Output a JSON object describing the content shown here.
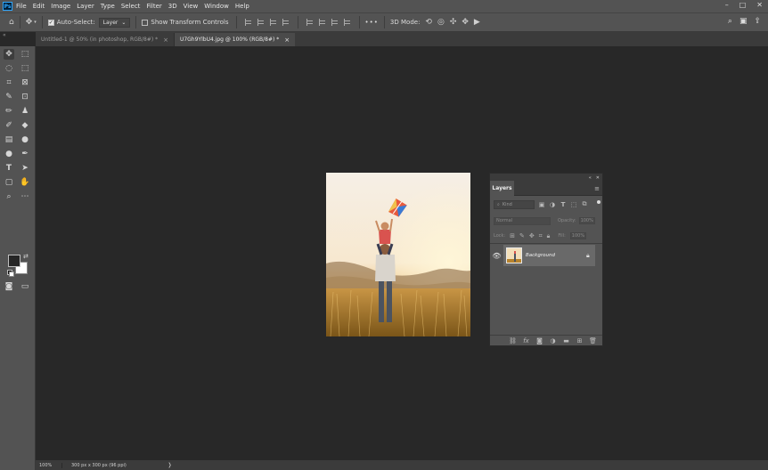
{
  "app": {
    "logo": "Ps"
  },
  "menu": [
    "File",
    "Edit",
    "Image",
    "Layer",
    "Type",
    "Select",
    "Filter",
    "3D",
    "View",
    "Window",
    "Help"
  ],
  "window_controls": [
    "–",
    "□",
    "✕"
  ],
  "options_bar": {
    "auto_select_label": "Auto-Select:",
    "auto_select_checked": true,
    "target_select": "Layer",
    "show_transform_controls_label": "Show Transform Controls",
    "show_transform_controls_checked": false,
    "more_label": "•••",
    "mode_3d_label": "3D Mode:"
  },
  "tabs": [
    {
      "title": "Untitled-1 @ 50% (in photoshop, RGB/8#) *",
      "active": false
    },
    {
      "title": "U7Gh9YlbU4.jpg @ 100% (RGB/8#) *",
      "active": true
    }
  ],
  "colors": {
    "foreground": "#262626",
    "background": "#ffffff"
  },
  "layers_panel": {
    "tab_label": "Layers",
    "kind_placeholder": "Kind",
    "blend_mode": "Normal",
    "opacity_label": "Opacity:",
    "opacity_value": "100%",
    "lock_label": "Lock:",
    "fill_label": "Fill:",
    "fill_value": "100%",
    "layers": [
      {
        "name": "Background",
        "visible": true,
        "locked": true
      }
    ]
  },
  "status_bar": {
    "zoom": "100%",
    "doc_info": "300 px x 300 px (96 ppi)"
  }
}
